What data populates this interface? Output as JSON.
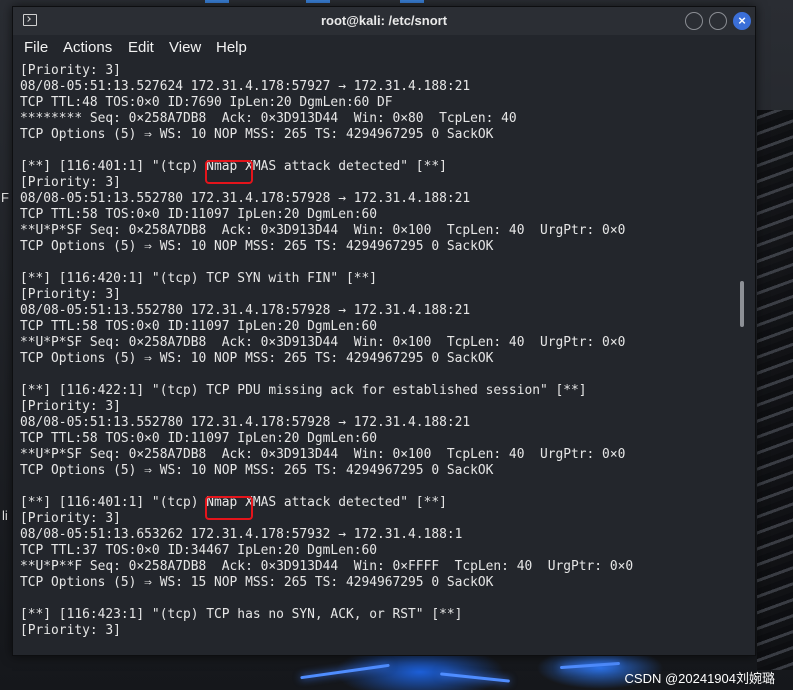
{
  "window": {
    "title": "root@kali: /etc/snort",
    "close_glyph": "×"
  },
  "menu": [
    "File",
    "Actions",
    "Edit",
    "View",
    "Help"
  ],
  "terminal": {
    "lines": [
      "[Priority: 3]",
      "08/08-05:51:13.527624 172.31.4.178:57927 → 172.31.4.188:21",
      "TCP TTL:48 TOS:0×0 ID:7690 IpLen:20 DgmLen:60 DF",
      "******** Seq: 0×258A7DB8  Ack: 0×3D913D44  Win: 0×80  TcpLen: 40",
      "TCP Options (5) ⇒ WS: 10 NOP MSS: 265 TS: 4294967295 0 SackOK",
      "",
      "[**] [116:401:1] \"(tcp) Nmap XMAS attack detected\" [**]",
      "[Priority: 3]",
      "08/08-05:51:13.552780 172.31.4.178:57928 → 172.31.4.188:21",
      "TCP TTL:58 TOS:0×0 ID:11097 IpLen:20 DgmLen:60",
      "**U*P*SF Seq: 0×258A7DB8  Ack: 0×3D913D44  Win: 0×100  TcpLen: 40  UrgPtr: 0×0",
      "TCP Options (5) ⇒ WS: 10 NOP MSS: 265 TS: 4294967295 0 SackOK",
      "",
      "[**] [116:420:1] \"(tcp) TCP SYN with FIN\" [**]",
      "[Priority: 3]",
      "08/08-05:51:13.552780 172.31.4.178:57928 → 172.31.4.188:21",
      "TCP TTL:58 TOS:0×0 ID:11097 IpLen:20 DgmLen:60",
      "**U*P*SF Seq: 0×258A7DB8  Ack: 0×3D913D44  Win: 0×100  TcpLen: 40  UrgPtr: 0×0",
      "TCP Options (5) ⇒ WS: 10 NOP MSS: 265 TS: 4294967295 0 SackOK",
      "",
      "[**] [116:422:1] \"(tcp) TCP PDU missing ack for established session\" [**]",
      "[Priority: 3]",
      "08/08-05:51:13.552780 172.31.4.178:57928 → 172.31.4.188:21",
      "TCP TTL:58 TOS:0×0 ID:11097 IpLen:20 DgmLen:60",
      "**U*P*SF Seq: 0×258A7DB8  Ack: 0×3D913D44  Win: 0×100  TcpLen: 40  UrgPtr: 0×0",
      "TCP Options (5) ⇒ WS: 10 NOP MSS: 265 TS: 4294967295 0 SackOK",
      "",
      "[**] [116:401:1] \"(tcp) Nmap XMAS attack detected\" [**]",
      "[Priority: 3]",
      "08/08-05:51:13.653262 172.31.4.178:57932 → 172.31.4.188:1",
      "TCP TTL:37 TOS:0×0 ID:34467 IpLen:20 DgmLen:60",
      "**U*P**F Seq: 0×258A7DB8  Ack: 0×3D913D44  Win: 0×FFFF  TcpLen: 40  UrgPtr: 0×0",
      "TCP Options (5) ⇒ WS: 15 NOP MSS: 265 TS: 4294967295 0 SackOK",
      "",
      "[**] [116:423:1] \"(tcp) TCP has no SYN, ACK, or RST\" [**]",
      "[Priority: 3]"
    ],
    "highlight_color": "#e4141b"
  },
  "desktop": {
    "left_fragment_1": "F",
    "left_fragment_2": "li",
    "watermark": "CSDN @20241904刘婉璐"
  },
  "colors": {
    "terminal_bg": "#23262c",
    "terminal_fg": "#e6e6e6",
    "titlebar_bg": "#2b2e34",
    "accent": "#3b6fd8"
  }
}
